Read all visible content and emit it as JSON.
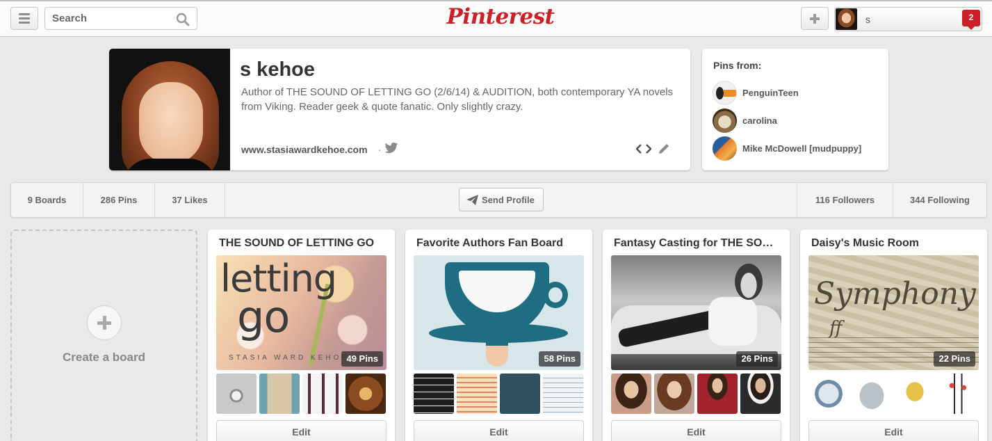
{
  "header": {
    "search_placeholder": "Search",
    "logo": "Pinterest",
    "user_name": "s",
    "notification_count": "2"
  },
  "profile": {
    "name": "s kehoe",
    "bio": "Author of THE SOUND OF LETTING GO (2/6/14) & AUDITION, both contemporary YA novels from Viking. Reader geek & quote fanatic. Only slightly crazy.",
    "website": "www.stasiawardkehoe.com",
    "separator": "·"
  },
  "pins_from": {
    "title": "Pins from:",
    "items": [
      {
        "label": "PenguinTeen",
        "icon": "penguin-teen-avatar"
      },
      {
        "label": "carolina",
        "icon": "cat-avatar"
      },
      {
        "label": "Mike McDowell [mudpuppy]",
        "icon": "user-avatar"
      }
    ]
  },
  "stats": {
    "boards": "9 Boards",
    "pins": "286 Pins",
    "likes": "37 Likes",
    "send_profile": "Send Profile",
    "followers": "116 Followers",
    "following": "344 Following"
  },
  "create_board": {
    "label": "Create a board"
  },
  "boards": [
    {
      "title": "THE SOUND OF LETTING GO",
      "pins": "49 Pins",
      "edit": "Edit",
      "cover_text_1": "letting",
      "cover_text_2": "go",
      "cover_byline": "STASIA WARD KEHOE"
    },
    {
      "title": "Favorite Authors Fan Board",
      "pins": "58 Pins",
      "edit": "Edit"
    },
    {
      "title": "Fantasy Casting for THE SOUND OF LETTING GO",
      "pins": "26 Pins",
      "edit": "Edit"
    },
    {
      "title": "Daisy's Music Room",
      "pins": "22 Pins",
      "edit": "Edit",
      "cover_text_1": "Symphony",
      "cover_text_2": "ff"
    }
  ],
  "colors": {
    "brand": "#cb2027",
    "background": "#e9e9e9"
  }
}
